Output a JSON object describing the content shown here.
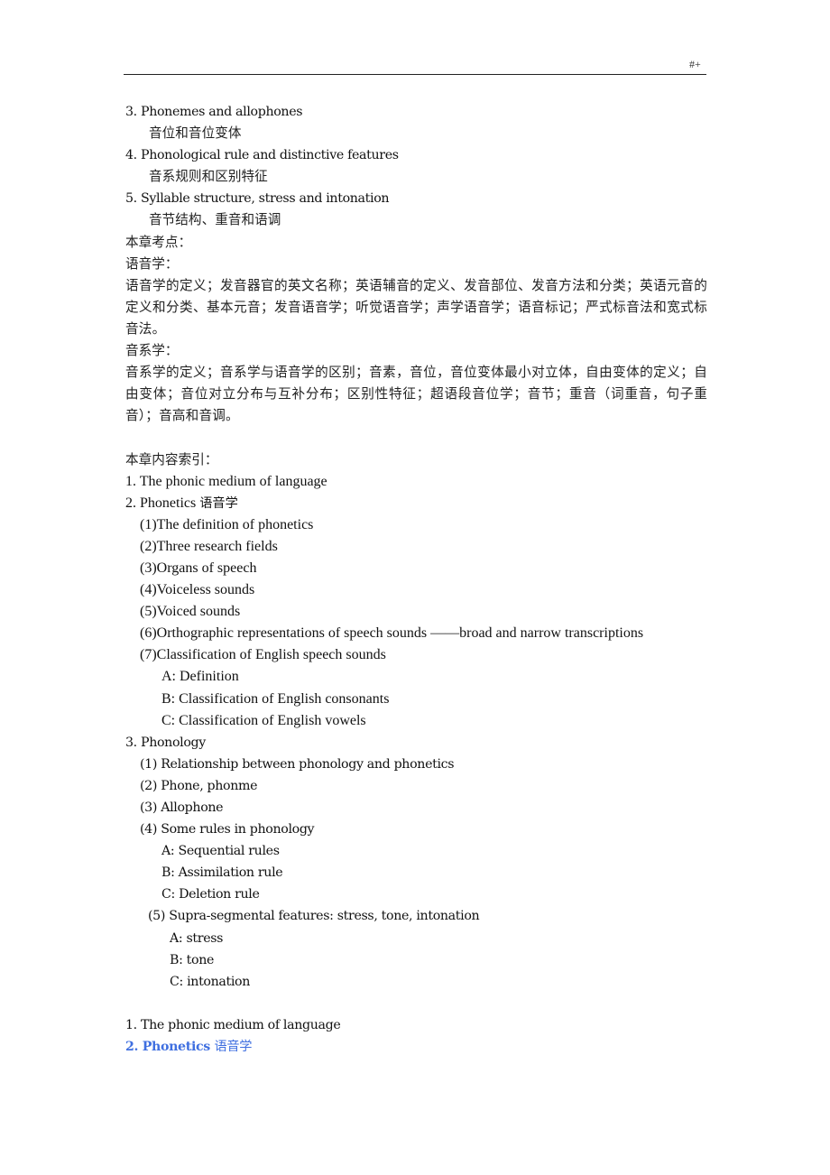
{
  "header": {
    "page_mark": "#+"
  },
  "top_items": [
    {
      "en": "3. Phonemes and allophones",
      "cn": "音位和音位变体"
    },
    {
      "en": "4. Phonological rule and distinctive features",
      "cn": "音系规则和区别特征"
    },
    {
      "en": "5. Syllable structure, stress and intonation",
      "cn": "音节结构、重音和语调"
    }
  ],
  "exam_points": {
    "title": "本章考点：",
    "phonetics_label": "语音学：",
    "phonetics_text": "语音学的定义；发音器官的英文名称；英语辅音的定义、发音部位、发音方法和分类；英语元音的定义和分类、基本元音；发音语音学；听觉语音学；声学语音学；语音标记；严式标音法和宽式标音法。",
    "phonology_label": "音系学：",
    "phonology_text": "音系学的定义；音系学与语音学的区别；音素，音位，音位变体最小对立体，自由变体的定义；自由变体；音位对立分布与互补分布；区别性特征；超语段音位学；音节；重音（词重音，句子重音）；音高和音调。"
  },
  "index": {
    "title": "本章内容索引：",
    "item1": "1. The phonic medium of language",
    "item2": {
      "en": "2. Phonetics",
      "cn": "语音学",
      "subs": [
        "(1)The definition of phonetics",
        "(2)Three research fields",
        "(3)Organs of speech",
        "(4)Voiceless sounds",
        "(5)Voiced sounds",
        "(6)Orthographic representations of speech sounds ——broad and narrow transcriptions",
        "(7)Classification of English speech sounds"
      ],
      "sub7_items": [
        "A: Definition",
        "B: Classification of English consonants",
        "C: Classification of English vowels"
      ]
    },
    "item3": {
      "en": "3. Phonology",
      "subs": [
        "(1) Relationship between phonology and phonetics",
        "(2) Phone, phonme",
        "(3) Allophone",
        "(4) Some rules in phonology"
      ],
      "sub4_items": [
        "A: Sequential rules",
        "B: Assimilation rule",
        "C: Deletion rule"
      ],
      "sub5": "(5) Supra-segmental features: stress, tone, intonation",
      "sub5_items": [
        "A: stress",
        "B: tone",
        "C: intonation"
      ]
    }
  },
  "body": {
    "section1": "1. The phonic medium of language",
    "section2_en": "2. Phonetics",
    "section2_cn": "语音学",
    "section2_color": "#3f6fe0"
  }
}
